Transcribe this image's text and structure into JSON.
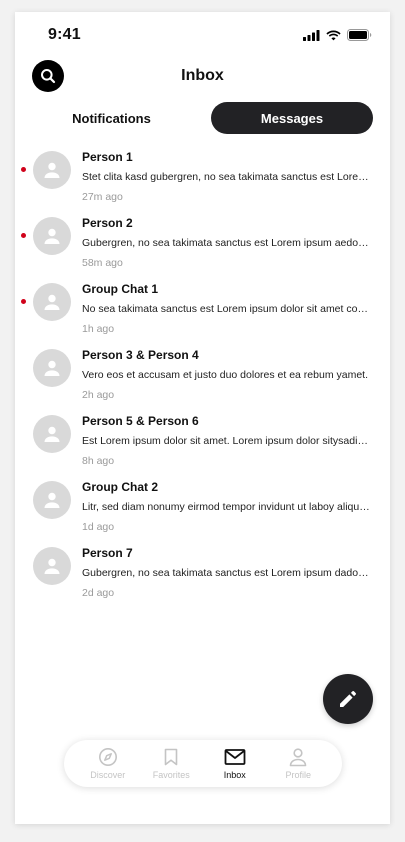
{
  "status_bar": {
    "time": "9:41"
  },
  "header": {
    "title": "Inbox"
  },
  "tabs": [
    {
      "label": "Notifications",
      "active": false
    },
    {
      "label": "Messages",
      "active": true
    }
  ],
  "messages": [
    {
      "name": "Person 1",
      "preview": "Stet clita kasd gubergren, no sea takimata sanctus est Lorem ipsum dolor sit amet.",
      "time": "27m ago",
      "unread": true
    },
    {
      "name": "Person 2",
      "preview": "Gubergren, no sea takimata sanctus est Lorem ipsum aedolor sit amet.",
      "time": "58m ago",
      "unread": true
    },
    {
      "name": "Group Chat 1",
      "preview": "No sea takimata sanctus est Lorem ipsum dolor sit amet consetetur.",
      "time": "1h ago",
      "unread": true
    },
    {
      "name": "Person 3 & Person 4",
      "preview": "Vero eos et accusam et justo duo dolores et ea rebum yamet.",
      "time": "2h ago",
      "unread": false
    },
    {
      "name": "Person 5 & Person 6",
      "preview": "Est Lorem ipsum dolor sit amet. Lorem ipsum dolor sitysadipscing.",
      "time": "8h ago",
      "unread": false
    },
    {
      "name": "Group Chat 2",
      "preview": "Litr, sed diam nonumy eirmod tempor invidunt ut laboy aliquyam.",
      "time": "1d ago",
      "unread": false
    },
    {
      "name": "Person 7",
      "preview": "Gubergren, no sea takimata sanctus est Lorem ipsum dadolor sit.",
      "time": "2d ago",
      "unread": false
    }
  ],
  "bottom_nav": [
    {
      "label": "Discover",
      "icon": "compass-icon",
      "active": false
    },
    {
      "label": "Favorites",
      "icon": "bookmark-icon",
      "active": false
    },
    {
      "label": "Inbox",
      "icon": "envelope-icon",
      "active": true
    },
    {
      "label": "Profile",
      "icon": "person-icon",
      "active": false
    }
  ],
  "colors": {
    "accent_dark": "#222225",
    "unread_dot": "#d0021b",
    "avatar_bg": "#d9d9d9",
    "timestamp": "#9a9a9a",
    "nav_inactive": "#c4c4c4"
  },
  "icons": {
    "search": "search-icon",
    "compose": "pencil-icon",
    "avatar": "person-icon",
    "status": [
      "signal-icon",
      "wifi-icon",
      "battery-icon"
    ]
  }
}
